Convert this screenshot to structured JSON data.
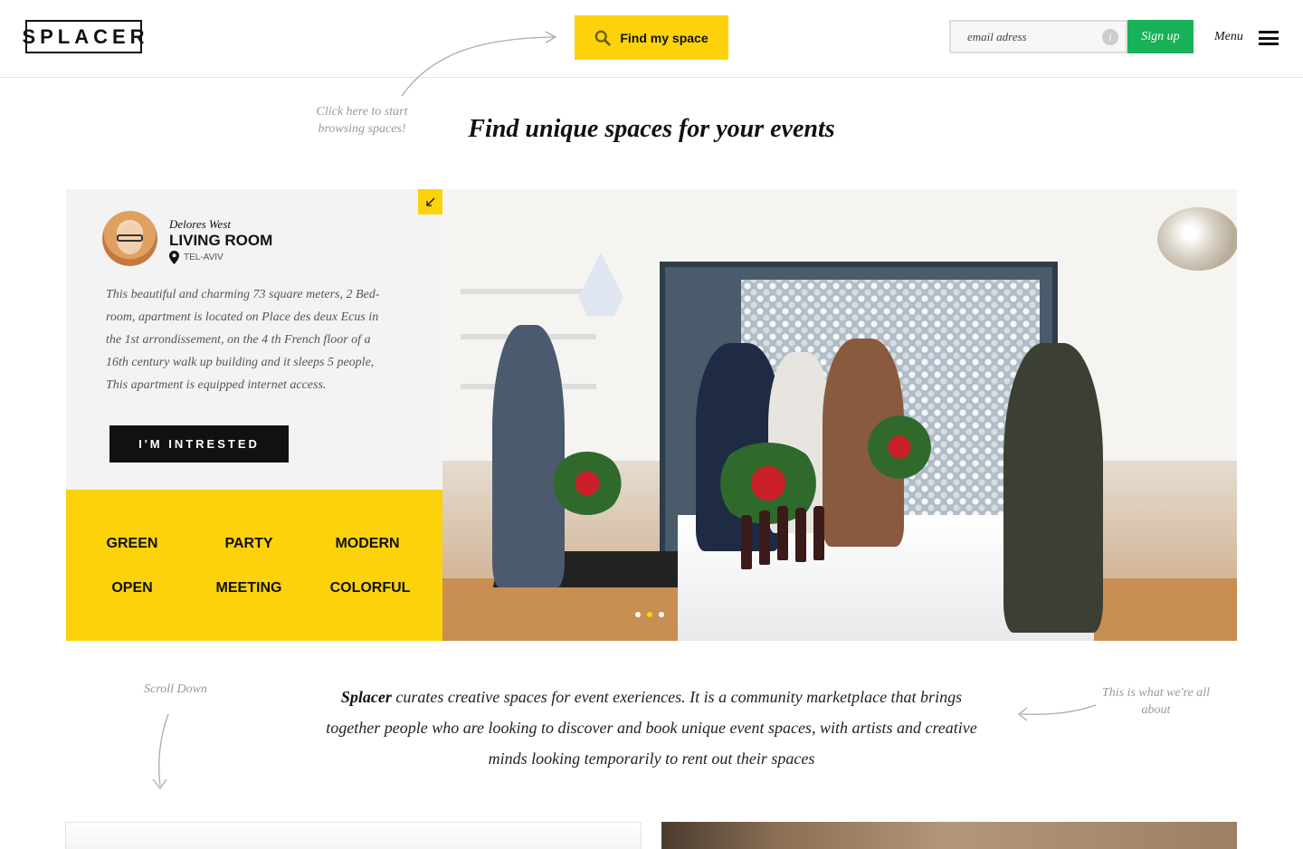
{
  "header": {
    "logo": "SPLACER",
    "find_button": "Find my space",
    "email_placeholder": "email adress",
    "info_glyph": "i",
    "signup_button": "Sign up",
    "menu_label": "Menu"
  },
  "hints": {
    "browse": "Click here to start browsing spaces!",
    "scroll": "Scroll Down",
    "about": "This is what we're all about"
  },
  "hero": {
    "title": "Find unique spaces for your events"
  },
  "featured": {
    "host": "Delores West",
    "space": "LIVING ROOM",
    "location": "TEL-AVIV",
    "description": "This beautiful and charming 73 square meters, 2 Bed-room, apartment is located on Place des deux Ecus in the 1st arrondissement, on the 4 th French floor of a 16th century walk up building and it sleeps 5 people, This apartment is equipped internet access.",
    "cta": "I'M INTRESTED",
    "tags": [
      "GREEN",
      "PARTY",
      "MODERN",
      "OPEN",
      "MEETING",
      "COLORFUL"
    ],
    "carousel": {
      "count": 3,
      "active": 1
    }
  },
  "about": {
    "brand": "Splacer",
    "text": " curates creative spaces for event exeriences. It is a community marketplace that brings together people who are looking to discover and book unique event spaces, with artists and creative minds looking temporarily to rent out their spaces"
  },
  "colors": {
    "accent_yellow": "#fcd20a",
    "signup_green": "#18b158",
    "dark": "#111111"
  },
  "icons": {
    "find": "search-icon",
    "info": "info-icon",
    "menu": "hamburger-icon",
    "location": "map-pin-icon",
    "corner": "arrow-collapse-icon"
  }
}
